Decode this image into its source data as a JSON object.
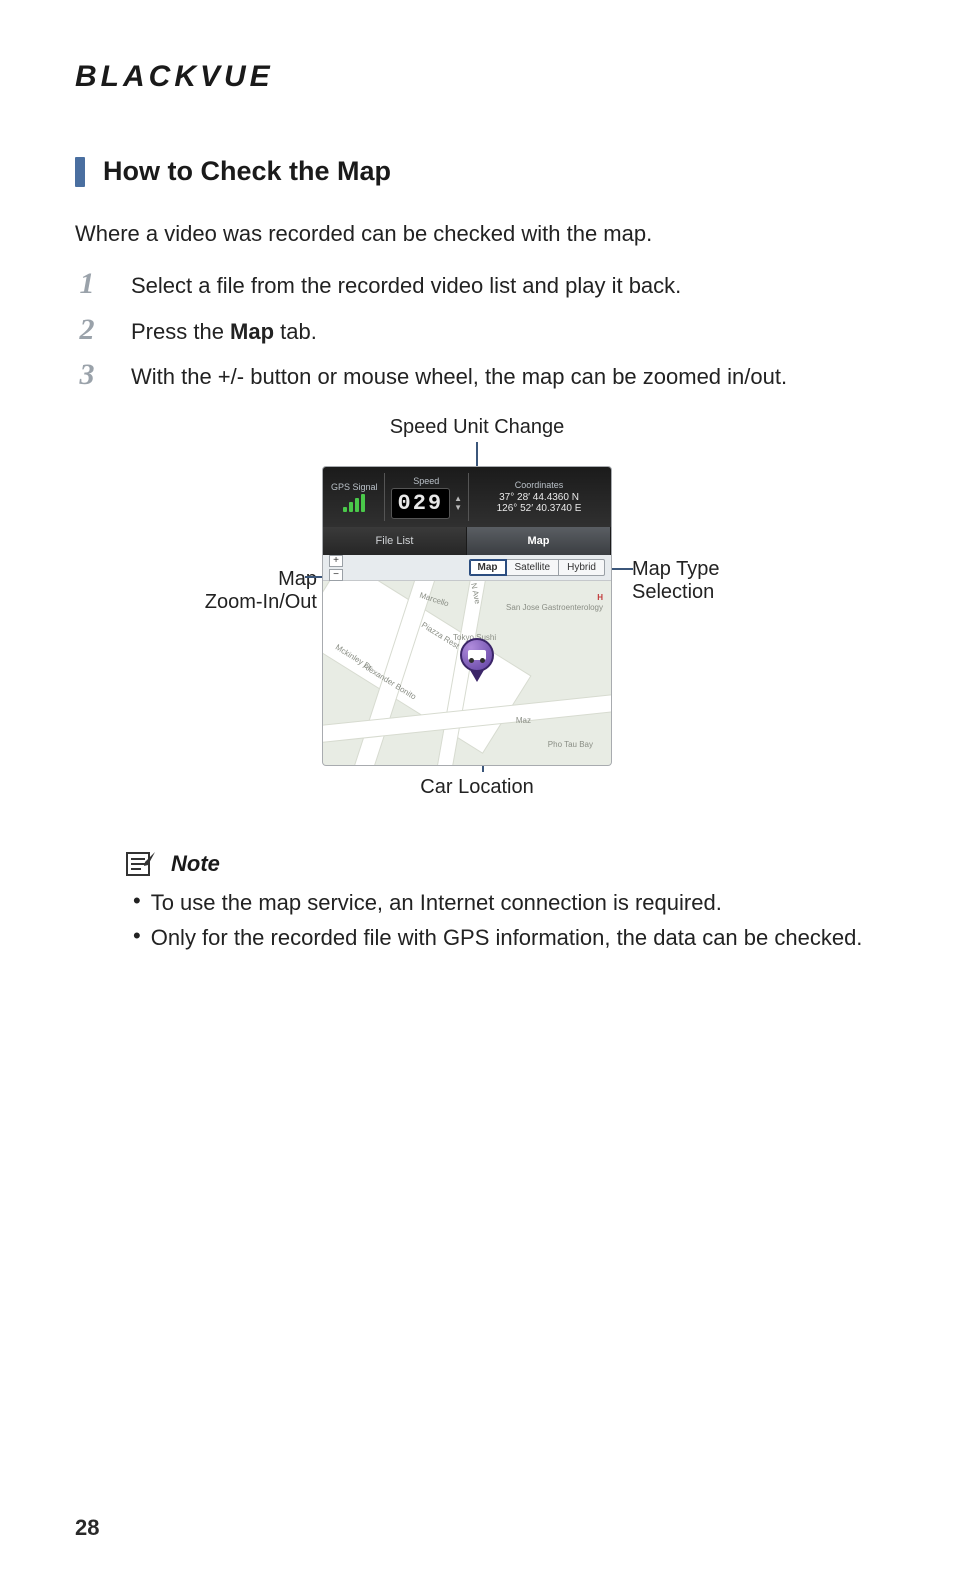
{
  "brand": "BLACKVUE",
  "section_title": "How to Check the Map",
  "intro": "Where a video was recorded can be checked with the map.",
  "steps": [
    {
      "num": "1",
      "text_before": "Select a file from the recorded video list and play it back.",
      "bold": "",
      "text_after": ""
    },
    {
      "num": "2",
      "text_before": "Press the ",
      "bold": "Map",
      "text_after": " tab."
    },
    {
      "num": "3",
      "text_before": "With the +/- button or mouse wheel, the map can be zoomed in/out.",
      "bold": "",
      "text_after": ""
    }
  ],
  "figure": {
    "labels": {
      "speed_unit": "Speed Unit Change",
      "zoom_line1": "Map",
      "zoom_line2": "Zoom-In/Out",
      "type_line1": "Map Type",
      "type_line2": "Selection",
      "car_location": "Car Location"
    },
    "device": {
      "gps_label": "GPS\nSignal",
      "speed_label": "Speed",
      "speed_value": "029",
      "coords_label": "Coordinates",
      "coord1": "37° 28′ 44.4360 N",
      "coord2": "126° 52′ 40.3740 E",
      "tabs": {
        "file_list": "File List",
        "map": "Map"
      },
      "zoom": {
        "in": "+",
        "out": "−"
      },
      "map_types": {
        "map": "Map",
        "satellite": "Satellite",
        "hybrid": "Hybrid"
      },
      "pois": {
        "mckinley": "Mckinley Dr",
        "alexander": "Alexander Bonito",
        "piazza": "Piazza Rest",
        "marcello": "Marcello",
        "ave": "N Ave",
        "tokyo": "Tokyo Sushi",
        "sanjose": "San Jose Gastroenterology",
        "h": "H",
        "maz": "Maz",
        "pho": "Pho Tau Bay"
      }
    }
  },
  "note": {
    "title": "Note",
    "items": [
      "To use the map service, an Internet connection is required.",
      "Only for the recorded file with GPS information, the data can be checked."
    ]
  },
  "page_number": "28"
}
